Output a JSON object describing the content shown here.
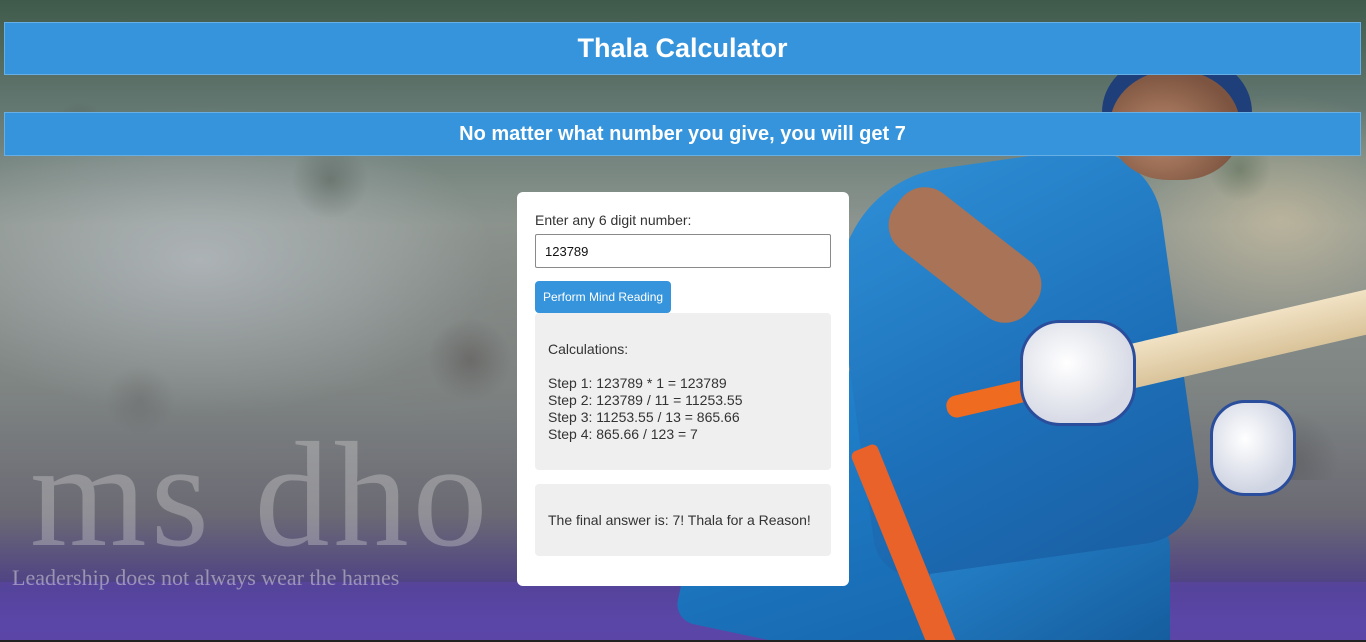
{
  "header": {
    "title": "Thala Calculator",
    "subtitle": "No matter what number you give, you will get 7"
  },
  "background": {
    "watermark": "ms dho",
    "tagline": "Leadership does not always wear the harnes"
  },
  "form": {
    "label": "Enter any 6 digit number:",
    "input_value": "123789",
    "button_label": "Perform Mind Reading"
  },
  "calculations": {
    "title": "Calculations:",
    "steps": [
      "Step 1: 123789 * 1 = 123789",
      "Step 2: 123789 / 11 = 11253.55",
      "Step 3: 11253.55 / 13 = 865.66",
      "Step 4: 865.66 / 123 = 7"
    ]
  },
  "result": {
    "text": "The final answer is: 7! Thala for a Reason!"
  },
  "colors": {
    "accent": "#3594db",
    "card": "#ffffff",
    "panel": "#efefef"
  }
}
